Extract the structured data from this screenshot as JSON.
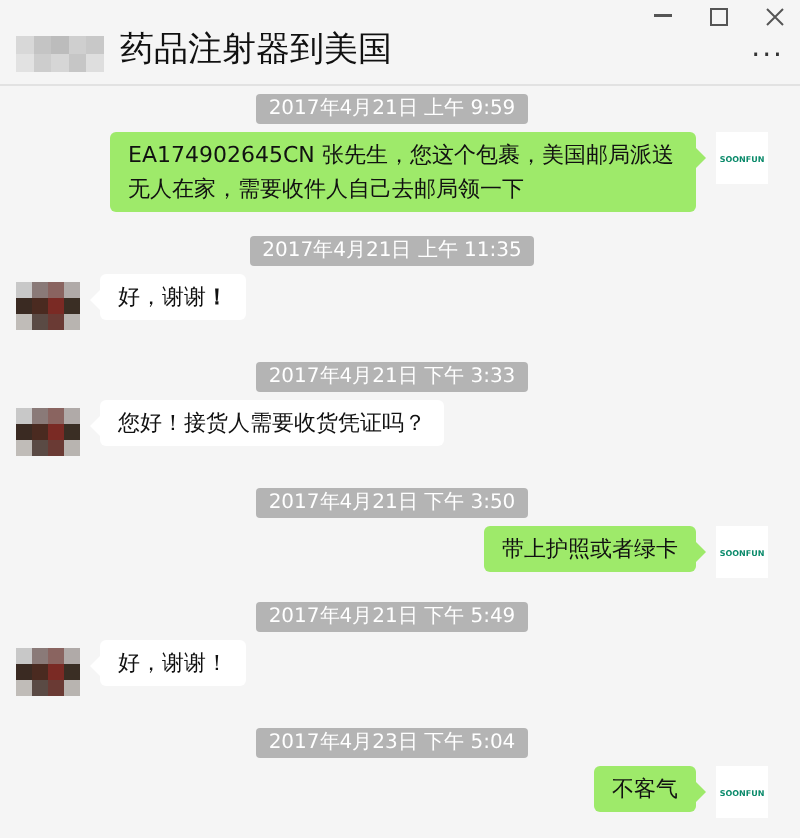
{
  "window": {
    "title": "药品注射器到美国",
    "more": "···"
  },
  "messages": [
    {
      "kind": "time",
      "text": "2017年4月21日 上午 9:59"
    },
    {
      "kind": "sent",
      "text": "EA174902645CN  张先生，您这个包裹，美国邮局派送无人在家，需要收件人自己去邮局领一下",
      "avatar": "SOONFUN"
    },
    {
      "kind": "time",
      "text": "2017年4月21日 上午 11:35"
    },
    {
      "kind": "received",
      "text": "好，谢谢**！**"
    },
    {
      "kind": "time",
      "text": "2017年4月21日 下午 3:33"
    },
    {
      "kind": "received",
      "text": "您好！接货人需要收货凭证吗？"
    },
    {
      "kind": "time",
      "text": "2017年4月21日 下午 3:50"
    },
    {
      "kind": "sent",
      "text": "带上护照或者绿卡",
      "avatar": "SOONFUN"
    },
    {
      "kind": "time",
      "text": "2017年4月21日 下午 5:49"
    },
    {
      "kind": "received",
      "text": "好，谢谢！"
    },
    {
      "kind": "time",
      "text": "2017年4月23日 下午 5:04"
    },
    {
      "kind": "sent",
      "text": "不客气",
      "avatar": "SOONFUN"
    }
  ]
}
